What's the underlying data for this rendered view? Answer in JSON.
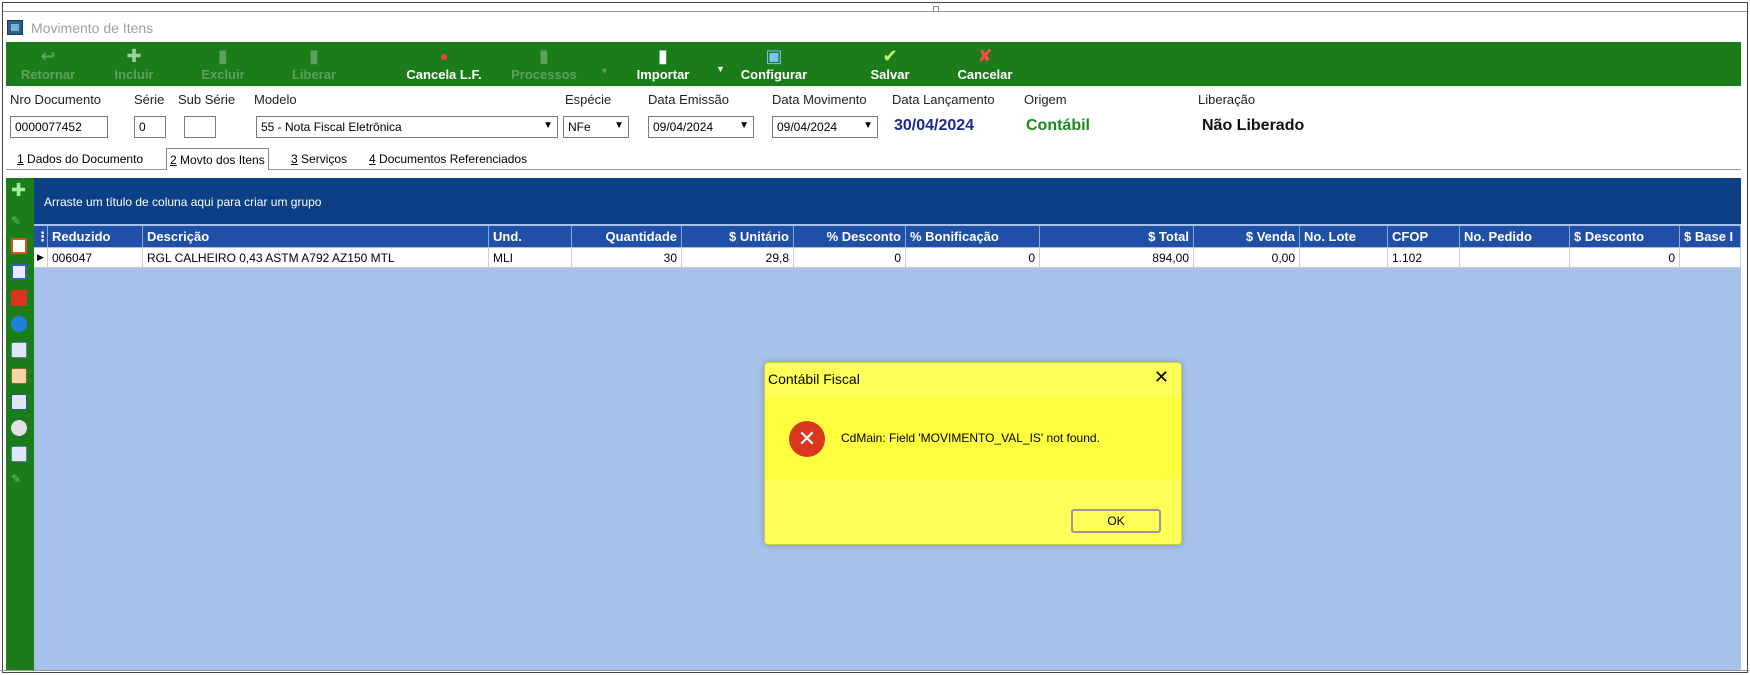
{
  "window": {
    "title": "Movimento de Itens"
  },
  "toolbar": {
    "retornar": "Retornar",
    "incluir": "Incluir",
    "excluir": "Excluir",
    "liberar": "Liberar",
    "cancela_lf": "Cancela L.F.",
    "processos": "Processos",
    "importar": "Importar",
    "configurar": "Configurar",
    "salvar": "Salvar",
    "cancelar": "Cancelar"
  },
  "fields": {
    "nro_documento": {
      "label": "Nro Documento",
      "value": "0000077452"
    },
    "serie": {
      "label": "Série",
      "value": "0"
    },
    "sub_serie": {
      "label": "Sub Série",
      "value": ""
    },
    "modelo": {
      "label": "Modelo",
      "value": "55 - Nota Fiscal Eletrônica"
    },
    "especie": {
      "label": "Espécie",
      "value": "NFe"
    },
    "data_emissao": {
      "label": "Data Emissão",
      "value": "09/04/2024"
    },
    "data_movimento": {
      "label": "Data Movimento",
      "value": "09/04/2024"
    },
    "data_lancamento": {
      "label": "Data Lançamento",
      "value": "30/04/2024"
    },
    "origem": {
      "label": "Origem",
      "value": "Contábil"
    },
    "liberacao": {
      "label": "Liberação",
      "value": "Não Liberado"
    }
  },
  "tabs": [
    {
      "num": "1",
      "label": " Dados do Documento"
    },
    {
      "num": "2",
      "label": " Movto dos Itens"
    },
    {
      "num": "3",
      "label": " Serviços"
    },
    {
      "num": "4",
      "label": " Documentos Referenciados"
    }
  ],
  "grid": {
    "group_hint": "Arraste um título de coluna aqui para criar um grupo",
    "columns": [
      "Reduzido",
      "Descrição",
      "Und.",
      "Quantidade",
      "$ Unitário",
      "% Desconto",
      "% Bonificação",
      "$ Total",
      "$ Venda",
      "No. Lote",
      "CFOP",
      "No. Pedido",
      "$ Desconto",
      "$ Base I"
    ],
    "row": [
      "006047",
      "RGL CALHEIRO 0,43 ASTM A792 AZ150 MTL",
      "MLI",
      "30",
      "29,8",
      "0",
      "0",
      "894,00",
      "0,00",
      "",
      "1.102",
      "",
      "0",
      ""
    ]
  },
  "dialog": {
    "title": "Contábil Fiscal",
    "message": "CdMain: Field 'MOVIMENTO_VAL_IS' not found.",
    "ok_label": "OK",
    "close_glyph": "✕"
  },
  "colors": {
    "toolbar": "#1a7d1a",
    "group_bar": "#0b3f86",
    "grid_header": "#1f4fa6",
    "grid_bg": "#a6c2ea",
    "dialog_bg": "#ffff5a",
    "origem": "#1a8a1a",
    "data_lancamento": "#1a2a8a"
  }
}
